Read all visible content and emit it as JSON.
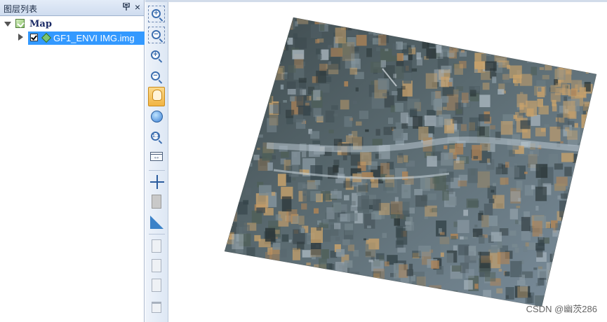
{
  "panel": {
    "title": "图层列表",
    "pin_icon": "pin-icon",
    "close_symbol": "×"
  },
  "tree": {
    "map_label": "Map",
    "layer_label": "GF1_ENVI IMG.img",
    "layer_checked": true
  },
  "toolbar": {
    "tools": [
      {
        "name": "zoom-in-box-tool",
        "icon": "zoom-in-icon"
      },
      {
        "name": "zoom-out-box-tool",
        "icon": "zoom-out-icon"
      },
      {
        "name": "fixed-zoom-in-tool",
        "icon": "zoom-in-icon"
      },
      {
        "name": "fixed-zoom-out-tool",
        "icon": "zoom-out-icon"
      },
      {
        "name": "pan-tool",
        "icon": "hand-icon",
        "active": true
      },
      {
        "name": "full-extent-tool",
        "icon": "globe-icon"
      },
      {
        "name": "zoom-1-to-1-tool",
        "icon": "zoom-1-1-icon",
        "label": "1:1"
      },
      {
        "name": "map-extent-tool",
        "icon": "extent-icon"
      },
      {
        "name": "identify-tool",
        "icon": "crosshair-icon"
      },
      {
        "name": "info-tool",
        "icon": "info-icon"
      },
      {
        "name": "measure-tool",
        "icon": "ruler-triangle-icon"
      },
      {
        "name": "copy-tool",
        "icon": "copy-icon",
        "enabled": false
      },
      {
        "name": "edit-tool",
        "icon": "edit-doc-icon",
        "enabled": false
      },
      {
        "name": "paste-tool",
        "icon": "paste-icon",
        "enabled": false
      },
      {
        "name": "delete-tool",
        "icon": "trash-icon",
        "enabled": false
      }
    ]
  },
  "map": {
    "watermark": "CSDN @幽茨286",
    "raster_colors": [
      "#3d4a4f",
      "#56656b",
      "#6f7f86",
      "#2b3638",
      "#8a9aa3",
      "#9c8a6a",
      "#c9a26b",
      "#4f5f58",
      "#7b8b92",
      "#a7b4bd",
      "#36454a",
      "#b08456"
    ]
  },
  "colors": {
    "selection": "#3399ff",
    "active_tool": "#f1b443",
    "panel_header": "#cfdcef"
  }
}
